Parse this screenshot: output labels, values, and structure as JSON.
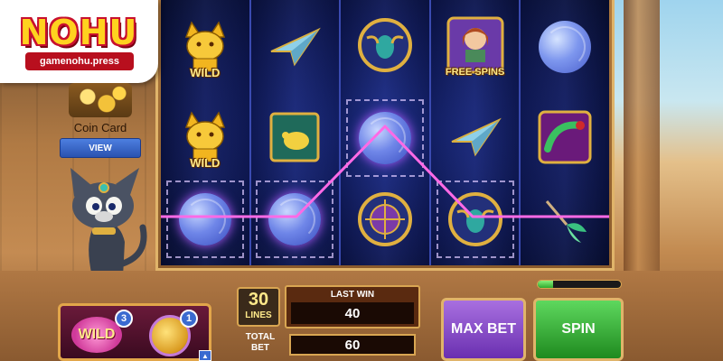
{
  "logo": {
    "title": "NOHU",
    "site": "gamenohu.press"
  },
  "coin_card": {
    "label": "Coin Card",
    "view_label": "VIEW"
  },
  "reels": {
    "symbols": {
      "wild": "WILD",
      "free_spins": "FREE SPINS"
    }
  },
  "bonus": {
    "wild_label": "WILD",
    "wild_count": "3",
    "coins_count": "1"
  },
  "controls": {
    "lines_value": "30",
    "lines_label": "LINES",
    "last_win_label": "LAST WIN",
    "last_win_value": "40",
    "total_bet_label": "TOTAL BET",
    "total_bet_value": "60",
    "max_bet_label": "MAX BET",
    "spin_label": "SPIN",
    "progress_fraction": 0.18
  },
  "colors": {
    "reel_bg": "#0f1a5e",
    "payline": "#ff6ae6",
    "spin_green": "#1f8a1f",
    "max_bet_purple": "#6a2fb0",
    "logo_yellow": "#ffd21f",
    "logo_red": "#c8102e"
  },
  "icons": [
    "wild-cat-icon",
    "paper-plane-icon",
    "scarab-icon",
    "explorer-girl-icon",
    "yarn-ball-icon",
    "mouse-toy-icon",
    "snake-bracelet-icon",
    "astrolabe-icon",
    "feather-toy-icon"
  ]
}
